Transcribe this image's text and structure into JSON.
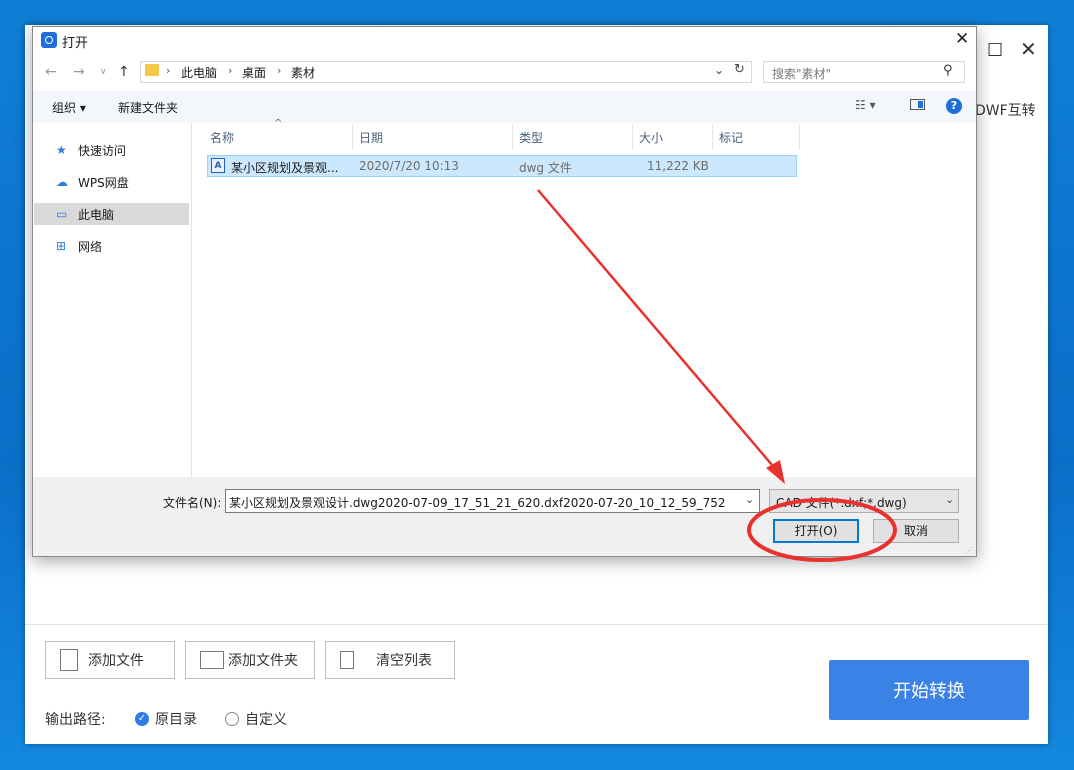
{
  "app": {
    "tab_text": "DWF互转",
    "buttons": {
      "add_file": "添加文件",
      "add_folder": "添加文件夹",
      "clear_list": "清空列表",
      "start": "开始转换"
    },
    "output": {
      "label": "输出路径:",
      "option_original": "原目录",
      "option_custom": "自定义",
      "selected": "original"
    }
  },
  "dialog": {
    "title": "打开",
    "breadcrumb": [
      "此电脑",
      "桌面",
      "素材"
    ],
    "search_placeholder": "搜索\"素材\"",
    "toolbar": {
      "organize": "组织 ▾",
      "new_folder": "新建文件夹"
    },
    "nav": [
      {
        "label": "快速访问",
        "icon": "star-icon"
      },
      {
        "label": "WPS网盘",
        "icon": "cloud-icon"
      },
      {
        "label": "此电脑",
        "icon": "computer-icon",
        "selected": true
      },
      {
        "label": "网络",
        "icon": "network-icon"
      }
    ],
    "columns": {
      "name": "名称",
      "date": "日期",
      "type": "类型",
      "size": "大小",
      "tags": "标记"
    },
    "files": [
      {
        "name": "某小区规划及景观...",
        "date": "2020/7/20 10:13",
        "type": "dwg 文件",
        "size": "11,222 KB"
      }
    ],
    "filename_label": "文件名(N):",
    "filename_value": "某小区规划及景观设计.dwg2020-07-09_17_51_21_620.dxf2020-07-20_10_12_59_752",
    "filetype_value": "CAD 文件(*.dxf;*.dwg)",
    "open_button": "打开(O)",
    "cancel_button": "取消"
  },
  "colors": {
    "accent": "#3b82e6",
    "annotation": "#e8322e",
    "selection": "#cce8ff"
  }
}
